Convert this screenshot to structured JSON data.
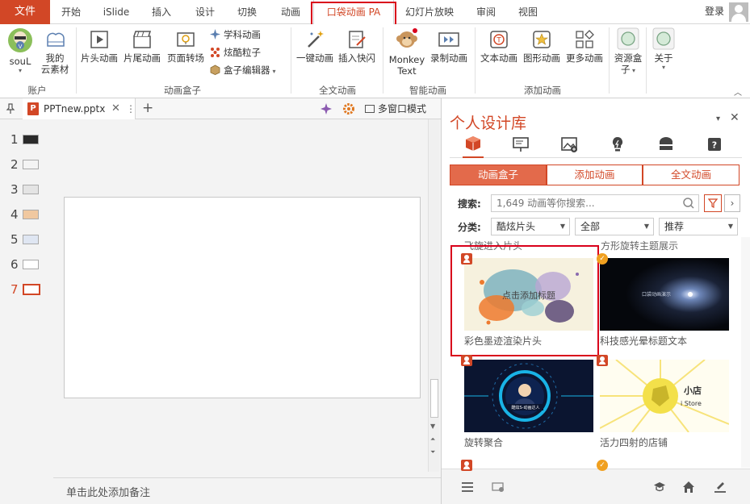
{
  "menu": {
    "file": "文件",
    "tabs": [
      "开始",
      "iSlide",
      "插入",
      "设计",
      "切换",
      "动画",
      "口袋动画 PA",
      "幻灯片放映",
      "审阅",
      "视图"
    ],
    "login": "登录"
  },
  "ribbon": {
    "account": {
      "soul": "souL",
      "cloud_line1": "我的",
      "cloud_line2": "云素材",
      "label": "账户"
    },
    "box": {
      "head_anim": "片头动画",
      "tail_anim": "片尾动画",
      "page_trans": "页面转场",
      "subject_anim": "学科动画",
      "particles": "炫酷粒子",
      "box_editor": "盒子编辑器",
      "label": "动画盒子"
    },
    "full": {
      "one_key": "一键动画",
      "insert_fast": "插入快闪",
      "label": "全文动画"
    },
    "smart": {
      "monkey_line1": "Monkey",
      "monkey_line2": "Text",
      "record": "录制动画",
      "label": "智能动画"
    },
    "add": {
      "text_anim": "文本动画",
      "shape_anim": "图形动画",
      "more_anim": "更多动画",
      "label": "添加动画"
    },
    "resource": {
      "line1": "资源盒",
      "line2": "子"
    },
    "about": "关于"
  },
  "doc": {
    "tab_name": "PPTnew.pptx",
    "multi_window": "多窗口模式",
    "notes_placeholder": "单击此处添加备注"
  },
  "slides": [
    {
      "num": "1"
    },
    {
      "num": "2"
    },
    {
      "num": "3"
    },
    {
      "num": "4"
    },
    {
      "num": "5"
    },
    {
      "num": "6"
    },
    {
      "num": "7"
    }
  ],
  "panel": {
    "title": "个人设计库",
    "segments": [
      "动画盒子",
      "添加动画",
      "全文动画"
    ],
    "search_label": "搜索:",
    "search_placeholder": "1,649 动画等你搜索...",
    "category_label": "分类:",
    "category": "酷炫片头",
    "scope": "全部",
    "sort": "推荐",
    "partial_captions": [
      "飞旋进入片头",
      "方形旋转主题展示"
    ],
    "cards": [
      {
        "caption": "彩色墨迹渲染片头",
        "thumb_text": "点击添加标题"
      },
      {
        "caption": "科技感光晕标题文本",
        "thumb_text": "口袋动画演示"
      },
      {
        "caption": "旋转聚合",
        "thumb_text": "酷炫S-动画达人"
      },
      {
        "caption": "活力四射的店铺",
        "thumb_text_1": "小店",
        "thumb_text_2": "i Store"
      }
    ]
  },
  "colors": {
    "accent": "#d24726",
    "highlight": "#d9001b"
  }
}
